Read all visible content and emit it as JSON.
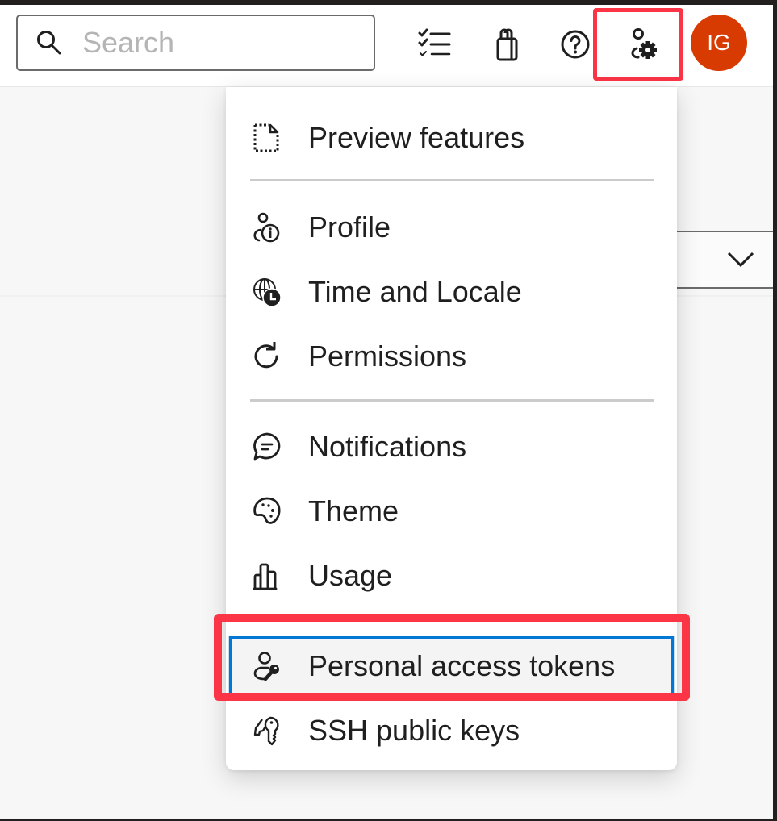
{
  "header": {
    "search": {
      "placeholder": "Search",
      "value": ""
    },
    "icons": [
      {
        "name": "work-items-checklist-icon",
        "label": ""
      },
      {
        "name": "marketplace-bag-icon",
        "label": ""
      },
      {
        "name": "help-icon",
        "label": ""
      },
      {
        "name": "user-settings-icon",
        "label": ""
      }
    ],
    "avatar": {
      "initials": "IG",
      "color": "#d83b01"
    }
  },
  "menu": {
    "items": [
      {
        "label": "Preview features",
        "icon": "preview-document-icon"
      },
      {
        "label": "Profile",
        "icon": "profile-info-icon"
      },
      {
        "label": "Time and Locale",
        "icon": "globe-clock-icon"
      },
      {
        "label": "Permissions",
        "icon": "refresh-icon"
      },
      {
        "label": "Notifications",
        "icon": "chat-bubble-icon"
      },
      {
        "label": "Theme",
        "icon": "palette-icon"
      },
      {
        "label": "Usage",
        "icon": "bar-chart-icon"
      },
      {
        "label": "Personal access tokens",
        "icon": "person-key-icon",
        "selected": true
      },
      {
        "label": "SSH public keys",
        "icon": "keys-icon"
      }
    ]
  },
  "colors": {
    "highlight": "#fb3446",
    "focus": "#0078d4",
    "avatar": "#d83b01"
  }
}
